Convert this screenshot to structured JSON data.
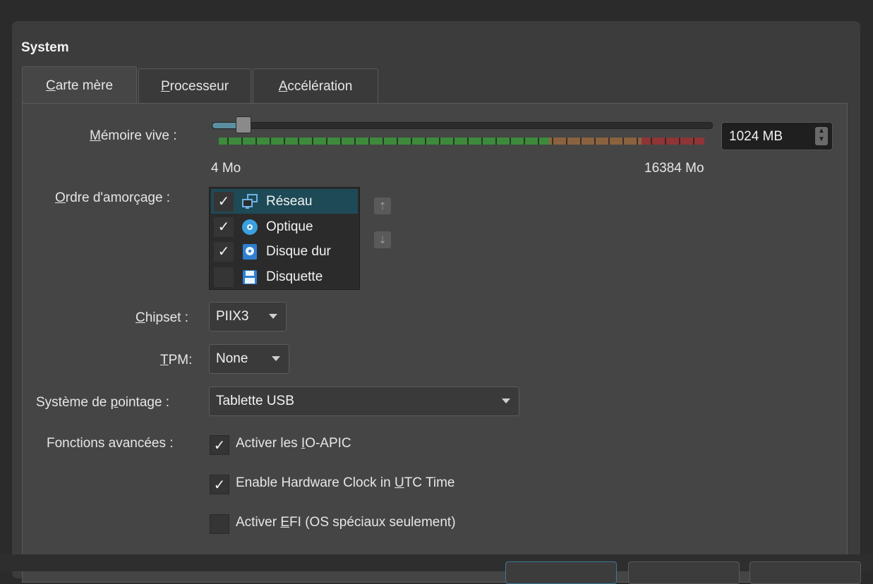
{
  "section": {
    "title": "System"
  },
  "tabs": [
    {
      "underline": "C",
      "rest": "arte mère"
    },
    {
      "underline": "P",
      "rest": "rocesseur"
    },
    {
      "underline": "A",
      "rest": "ccélération"
    }
  ],
  "memory": {
    "label_u": "M",
    "label_rest": "émoire vive :",
    "min_label": "4 Mo",
    "max_label": "16384 Mo",
    "value": "1024 MB",
    "slider_fraction": 0.0623
  },
  "boot": {
    "label_u": "O",
    "label_rest": "rdre d'amorçage :",
    "items": [
      {
        "label": "Réseau",
        "checked": "✓",
        "icon": "network-icon"
      },
      {
        "label": "Optique",
        "checked": "✓",
        "icon": "optical-disc-icon"
      },
      {
        "label": "Disque dur",
        "checked": "✓",
        "icon": "hard-disk-icon"
      },
      {
        "label": "Disquette",
        "checked": "",
        "icon": "floppy-icon"
      }
    ]
  },
  "chipset": {
    "label_u": "C",
    "label_rest": "hipset :",
    "value": "PIIX3"
  },
  "tpm": {
    "label_u": "T",
    "label_rest": "PM:",
    "value": "None"
  },
  "pointing": {
    "label_pre": "Système de ",
    "label_u": "p",
    "label_rest": "ointage :",
    "value": "Tablette USB"
  },
  "advanced": {
    "label": "Fonctions avancées :",
    "ioapic": {
      "pre": "Activer les ",
      "u": "I",
      "rest": "O-APIC",
      "check": "✓"
    },
    "utc": {
      "pre": "Enable Hardware Clock in ",
      "u": "U",
      "rest": "TC Time",
      "check": "✓"
    },
    "efi": {
      "pre": "Activer ",
      "u": "E",
      "rest": "FI (OS spéciaux seulement)",
      "check": ""
    }
  },
  "colors": {
    "accent": "#1e4a57",
    "background": "#3c3c3c"
  }
}
